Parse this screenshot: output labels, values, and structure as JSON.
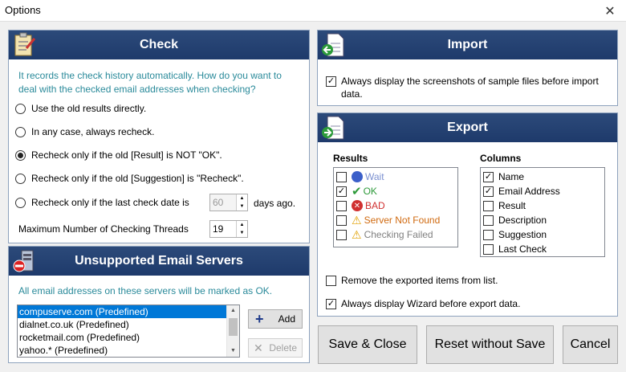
{
  "window": {
    "title": "Options",
    "close_glyph": "✕"
  },
  "check": {
    "title": "Check",
    "info": "It records the check history automatically. How do you want to deal with the checked email addresses when checking?",
    "options": [
      {
        "label": "Use the old results directly.",
        "selected": false
      },
      {
        "label": "In any case, always recheck.",
        "selected": false
      },
      {
        "label": "Recheck only if the old [Result] is NOT \"OK\".",
        "selected": true
      },
      {
        "label": "Recheck only if the old [Suggestion] is \"Recheck\".",
        "selected": false
      },
      {
        "label": "Recheck only if the last check date is",
        "selected": false
      }
    ],
    "days_value": "60",
    "days_suffix": "days ago.",
    "threads_label": "Maximum Number of Checking Threads",
    "threads_value": "19"
  },
  "servers": {
    "title": "Unsupported Email Servers",
    "info": "All email addresses on these servers will be marked as OK.",
    "items": [
      "compuserve.com (Predefined)",
      "dialnet.co.uk (Predefined)",
      "rocketmail.com (Predefined)",
      "yahoo.* (Predefined)"
    ],
    "selected_index": 0,
    "add_label": "Add",
    "delete_label": "Delete"
  },
  "import": {
    "title": "Import",
    "always_display_label": "Always display the screenshots of sample files before import data.",
    "always_display_checked": true
  },
  "export": {
    "title": "Export",
    "results_label": "Results",
    "results": [
      {
        "label": "Wait",
        "checked": false,
        "icon": "wait-icon",
        "color": "#7a8fd0"
      },
      {
        "label": "OK",
        "checked": true,
        "icon": "ok-check-icon",
        "color": "#2e9a3a"
      },
      {
        "label": "BAD",
        "checked": false,
        "icon": "bad-x-icon",
        "color": "#d03030"
      },
      {
        "label": "Server Not Found",
        "checked": false,
        "icon": "warning-icon",
        "color": "#d06a10"
      },
      {
        "label": "Checking Failed",
        "checked": false,
        "icon": "warning-icon",
        "color": "#808080"
      }
    ],
    "columns_label": "Columns",
    "columns": [
      {
        "label": "Name",
        "checked": true
      },
      {
        "label": "Email Address",
        "checked": true
      },
      {
        "label": "Result",
        "checked": false
      },
      {
        "label": "Description",
        "checked": false
      },
      {
        "label": "Suggestion",
        "checked": false
      },
      {
        "label": "Last Check",
        "checked": false
      }
    ],
    "remove_label": "Remove the exported items from list.",
    "remove_checked": false,
    "wizard_label": "Always display Wizard before export data.",
    "wizard_checked": true
  },
  "footer": {
    "save_label": "Save & Close",
    "reset_label": "Reset without Save",
    "cancel_label": "Cancel"
  },
  "colors": {
    "header_bg": "#1e3a6b",
    "info_text": "#2a8a9a",
    "selection": "#0078d7"
  }
}
